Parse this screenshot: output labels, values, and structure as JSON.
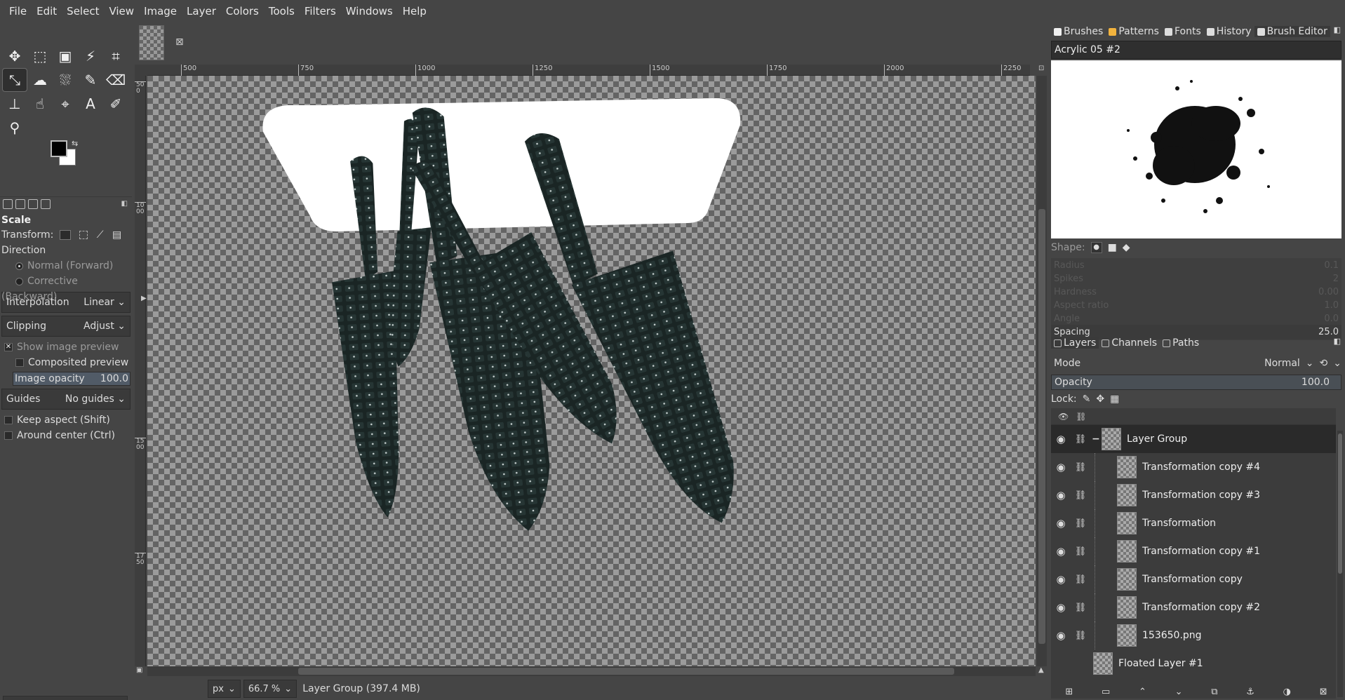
{
  "menubar": {
    "items": [
      "File",
      "Edit",
      "Select",
      "View",
      "Image",
      "Layer",
      "Colors",
      "Tools",
      "Filters",
      "Windows",
      "Help"
    ]
  },
  "toolbox": {
    "tools": [
      {
        "name": "move-tool-icon",
        "glyph": "✥"
      },
      {
        "name": "rect-select-tool-icon",
        "glyph": "⬚"
      },
      {
        "name": "foreground-select-tool-icon",
        "glyph": "▣"
      },
      {
        "name": "fuzzy-select-tool-icon",
        "glyph": "⚡"
      },
      {
        "name": "crop-tool-icon",
        "glyph": "⌗"
      },
      {
        "name": "scale-tool-icon",
        "glyph": "⤡"
      },
      {
        "name": "warp-transform-tool-icon",
        "glyph": "☁"
      },
      {
        "name": "bucket-fill-tool-icon",
        "glyph": "⛆"
      },
      {
        "name": "paintbrush-tool-icon",
        "glyph": "✎"
      },
      {
        "name": "eraser-tool-icon",
        "glyph": "⌫"
      },
      {
        "name": "clone-tool-icon",
        "glyph": "⊥"
      },
      {
        "name": "smudge-tool-icon",
        "glyph": "☝"
      },
      {
        "name": "paths-tool-icon",
        "glyph": "⌖"
      },
      {
        "name": "text-tool-icon",
        "glyph": "A"
      },
      {
        "name": "color-picker-tool-icon",
        "glyph": "✐"
      },
      {
        "name": "zoom-tool-icon",
        "glyph": "⚲"
      }
    ]
  },
  "tool_options": {
    "title": "Scale",
    "transform_label": "Transform:",
    "direction_label": "Direction",
    "direction_normal": "Normal (Forward)",
    "direction_corrective": "Corrective (Backward)",
    "interpolation_label": "Interpolation",
    "interpolation_value": "Linear",
    "clipping_label": "Clipping",
    "clipping_value": "Adjust",
    "show_preview": "Show image preview",
    "composited_preview": "Composited preview",
    "image_opacity_label": "Image opacity",
    "image_opacity_value": "100.0",
    "image_opacity_fraction": 1.0,
    "guides_label": "Guides",
    "guides_value": "No guides",
    "keep_aspect": "Keep aspect (Shift)",
    "around_center": "Around center (Ctrl)"
  },
  "rulers": {
    "h_labels": [
      "500",
      "750",
      "1000",
      "1250",
      "1500",
      "1750",
      "2000",
      "2250"
    ],
    "v_labels": [
      "500",
      "1000",
      "1500",
      "1750"
    ]
  },
  "status": {
    "unit": "px",
    "zoom": "66.7 %",
    "layer_info": "Layer Group (397.4 MB)"
  },
  "dock_top": {
    "tabs": [
      {
        "label": "Brushes",
        "color": "#f0f0f0"
      },
      {
        "label": "Patterns",
        "color": "#f2b33d"
      },
      {
        "label": "Fonts",
        "color": "#dddddd"
      },
      {
        "label": "History",
        "color": "#dddddd"
      },
      {
        "label": "Brush Editor",
        "color": "#dddddd"
      }
    ],
    "brush_name": "Acrylic 05 #2",
    "shape_label": "Shape:",
    "params": [
      {
        "label": "Radius",
        "value": "0.1",
        "enabled": false
      },
      {
        "label": "Spikes",
        "value": "2",
        "enabled": false
      },
      {
        "label": "Hardness",
        "value": "0.00",
        "enabled": false
      },
      {
        "label": "Aspect ratio",
        "value": "1.0",
        "enabled": false
      },
      {
        "label": "Angle",
        "value": "0.0",
        "enabled": false
      },
      {
        "label": "Spacing",
        "value": "25.0",
        "enabled": true
      }
    ]
  },
  "dock_bottom": {
    "tabs": [
      {
        "label": "Layers"
      },
      {
        "label": "Channels"
      },
      {
        "label": "Paths"
      }
    ],
    "mode_label": "Mode",
    "mode_value": "Normal",
    "opacity_label": "Opacity",
    "opacity_value": "100.0",
    "lock_label": "Lock:",
    "layers": [
      {
        "name": "Layer Group",
        "group": true,
        "active": true,
        "visible": true
      },
      {
        "name": "Transformation copy #4",
        "group": false,
        "child": true,
        "visible": true
      },
      {
        "name": "Transformation copy #3",
        "group": false,
        "child": true,
        "visible": true
      },
      {
        "name": "Transformation",
        "group": false,
        "child": true,
        "visible": true
      },
      {
        "name": "Transformation copy #1",
        "group": false,
        "child": true,
        "visible": true
      },
      {
        "name": "Transformation copy",
        "group": false,
        "child": true,
        "visible": true
      },
      {
        "name": "Transformation copy #2",
        "group": false,
        "child": true,
        "visible": true
      },
      {
        "name": "153650.png",
        "group": false,
        "child": true,
        "visible": true
      },
      {
        "name": "Floated Layer #1",
        "group": false,
        "child": false,
        "visible": false
      }
    ]
  },
  "colors": {
    "foreground": "#000000",
    "background": "#ffffff",
    "knife": "#1a2524"
  }
}
